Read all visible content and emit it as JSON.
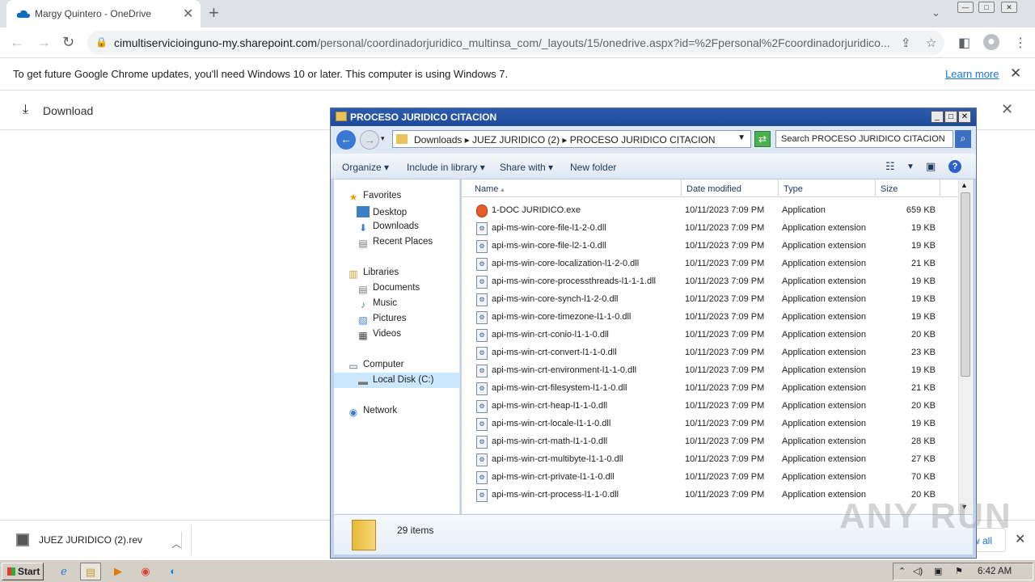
{
  "browser": {
    "tab_title": "Margy Quintero - OneDrive",
    "new_tab": "+",
    "url_host": "cimultiservicioinguno-my.sharepoint.com",
    "url_path": "/personal/coordinadorjuridico_multinsa_com/_layouts/15/onedrive.aspx?id=%2Fpersonal%2Fcoordinadorjuridico...",
    "win_min": "—",
    "win_max": "□",
    "win_close": "✕"
  },
  "infobar": {
    "message": "To get future Google Chrome updates, you'll need Windows 10 or later. This computer is using Windows 7.",
    "learn_more": "Learn more"
  },
  "onedrive": {
    "download_label": "Download"
  },
  "explorer": {
    "title": "PROCESO JURIDICO CITACION",
    "breadcrumbs": "Downloads ▸ JUEZ JURIDICO (2) ▸ PROCESO JURIDICO CITACION",
    "search_placeholder": "Search PROCESO JURIDICO CITACION",
    "commands": {
      "organize": "Organize",
      "include": "Include in library",
      "share": "Share with",
      "new_folder": "New folder"
    },
    "nav": {
      "favorites": "Favorites",
      "desktop": "Desktop",
      "downloads": "Downloads",
      "recent": "Recent Places",
      "libraries": "Libraries",
      "documents": "Documents",
      "music": "Music",
      "pictures": "Pictures",
      "videos": "Videos",
      "computer": "Computer",
      "local_disk": "Local Disk (C:)",
      "network": "Network"
    },
    "columns": {
      "name": "Name",
      "date": "Date modified",
      "type": "Type",
      "size": "Size"
    },
    "files": [
      {
        "name": "1-DOC JURIDICO.exe",
        "date": "10/11/2023 7:09 PM",
        "type": "Application",
        "size": "659 KB"
      },
      {
        "name": "api-ms-win-core-file-l1-2-0.dll",
        "date": "10/11/2023 7:09 PM",
        "type": "Application extension",
        "size": "19 KB"
      },
      {
        "name": "api-ms-win-core-file-l2-1-0.dll",
        "date": "10/11/2023 7:09 PM",
        "type": "Application extension",
        "size": "19 KB"
      },
      {
        "name": "api-ms-win-core-localization-l1-2-0.dll",
        "date": "10/11/2023 7:09 PM",
        "type": "Application extension",
        "size": "21 KB"
      },
      {
        "name": "api-ms-win-core-processthreads-l1-1-1.dll",
        "date": "10/11/2023 7:09 PM",
        "type": "Application extension",
        "size": "19 KB"
      },
      {
        "name": "api-ms-win-core-synch-l1-2-0.dll",
        "date": "10/11/2023 7:09 PM",
        "type": "Application extension",
        "size": "19 KB"
      },
      {
        "name": "api-ms-win-core-timezone-l1-1-0.dll",
        "date": "10/11/2023 7:09 PM",
        "type": "Application extension",
        "size": "19 KB"
      },
      {
        "name": "api-ms-win-crt-conio-l1-1-0.dll",
        "date": "10/11/2023 7:09 PM",
        "type": "Application extension",
        "size": "20 KB"
      },
      {
        "name": "api-ms-win-crt-convert-l1-1-0.dll",
        "date": "10/11/2023 7:09 PM",
        "type": "Application extension",
        "size": "23 KB"
      },
      {
        "name": "api-ms-win-crt-environment-l1-1-0.dll",
        "date": "10/11/2023 7:09 PM",
        "type": "Application extension",
        "size": "19 KB"
      },
      {
        "name": "api-ms-win-crt-filesystem-l1-1-0.dll",
        "date": "10/11/2023 7:09 PM",
        "type": "Application extension",
        "size": "21 KB"
      },
      {
        "name": "api-ms-win-crt-heap-l1-1-0.dll",
        "date": "10/11/2023 7:09 PM",
        "type": "Application extension",
        "size": "20 KB"
      },
      {
        "name": "api-ms-win-crt-locale-l1-1-0.dll",
        "date": "10/11/2023 7:09 PM",
        "type": "Application extension",
        "size": "19 KB"
      },
      {
        "name": "api-ms-win-crt-math-l1-1-0.dll",
        "date": "10/11/2023 7:09 PM",
        "type": "Application extension",
        "size": "28 KB"
      },
      {
        "name": "api-ms-win-crt-multibyte-l1-1-0.dll",
        "date": "10/11/2023 7:09 PM",
        "type": "Application extension",
        "size": "27 KB"
      },
      {
        "name": "api-ms-win-crt-private-l1-1-0.dll",
        "date": "10/11/2023 7:09 PM",
        "type": "Application extension",
        "size": "70 KB"
      },
      {
        "name": "api-ms-win-crt-process-l1-1-0.dll",
        "date": "10/11/2023 7:09 PM",
        "type": "Application extension",
        "size": "20 KB"
      }
    ],
    "item_count": "29 items"
  },
  "download_shelf": {
    "file_name": "JUEZ JURIDICO (2).rev",
    "show_all": "w all"
  },
  "watermark": "ANY RUN",
  "taskbar": {
    "start": "Start",
    "clock": "6:42 AM"
  },
  "icons": [
    "onedrive-icon",
    "back-icon",
    "forward-icon",
    "reload-icon",
    "lock-icon",
    "share-icon",
    "star-icon",
    "sidebar-icon",
    "profile-icon",
    "menu-icon",
    "close-icon",
    "download-icon",
    "folder-icon",
    "search-icon",
    "help-icon",
    "ie-icon",
    "explorer-icon",
    "media-icon",
    "chrome-icon",
    "edge-icon"
  ],
  "colors": {
    "chrome_tabbar": "#dee1e6",
    "link": "#1a73e8",
    "explorer_title": "#2c5cb0",
    "selected_nav": "#cce8ff"
  }
}
